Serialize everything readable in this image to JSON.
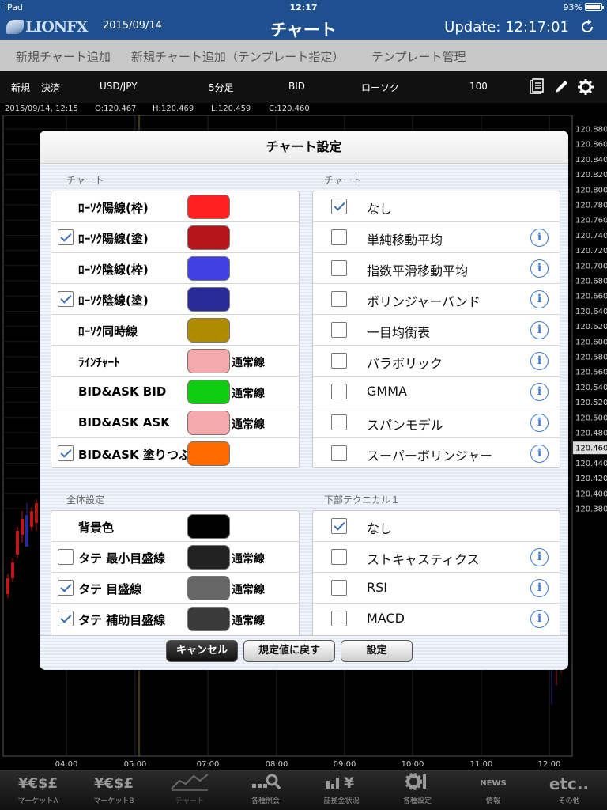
{
  "status_bar": {
    "device": "iPad",
    "time": "12:17",
    "battery": "93%"
  },
  "header": {
    "logo": "LIONFX",
    "date": "2015/09/14",
    "title": "チャート",
    "update": "Update: 12:17:01"
  },
  "sub_menu": [
    "新規チャート追加",
    "新規チャート追加（テンプレート指定）",
    "テンプレート管理"
  ],
  "toolbar": {
    "new": "新規",
    "settle": "決済",
    "pair": "USD/JPY",
    "interval": "5分足",
    "bid": "BID",
    "type": "ローソク",
    "count": "100"
  },
  "ohlc": {
    "time": "2015/09/14, 12:15",
    "o": "O:120.467",
    "h": "H:120.469",
    "l": "L:120.459",
    "c": "C:120.460"
  },
  "chart_data": {
    "type": "candlestick",
    "price_ticks": [
      "120.880",
      "120.860",
      "120.840",
      "120.820",
      "120.800",
      "120.780",
      "120.760",
      "120.740",
      "120.720",
      "120.700",
      "120.680",
      "120.660",
      "120.640",
      "120.620",
      "120.600",
      "120.580",
      "120.560",
      "120.540",
      "120.520",
      "120.500",
      "120.480",
      "120.460",
      "120.440",
      "120.420",
      "120.400",
      "120.380"
    ],
    "time_ticks": [
      "04:00",
      "05:00",
      "07:00",
      "08:00",
      "09:00",
      "10:00",
      "11:00",
      "12:00"
    ],
    "current_price": "120.460",
    "ylim": [
      120.37,
      120.89
    ]
  },
  "tabs": [
    {
      "icon": "¥€$£",
      "label": "マーケットA"
    },
    {
      "icon": "¥€$£",
      "label": "マーケットB"
    },
    {
      "icon": "",
      "label": "チャート"
    },
    {
      "icon": "",
      "label": "各種照会"
    },
    {
      "icon": "",
      "label": "証拠金状況"
    },
    {
      "icon": "",
      "label": "各種設定"
    },
    {
      "icon": "NEWS",
      "label": "情報"
    },
    {
      "icon": "etc..",
      "label": "その他"
    }
  ],
  "dialog": {
    "title": "チャート設定",
    "left_section_1": "チャート",
    "right_section_1": "チャート",
    "left_section_2": "全体設定",
    "right_section_2": "下部テクニカル１",
    "left_rows_1": [
      {
        "label": "ﾛｰｿｸ陽線(枠)",
        "checkbox": false,
        "checked": false,
        "color": "#ff2020",
        "note": ""
      },
      {
        "label": "ﾛｰｿｸ陽線(塗)",
        "checkbox": true,
        "checked": true,
        "color": "#b4141a",
        "note": ""
      },
      {
        "label": "ﾛｰｿｸ陰線(枠)",
        "checkbox": false,
        "checked": false,
        "color": "#4040e4",
        "note": ""
      },
      {
        "label": "ﾛｰｿｸ陰線(塗)",
        "checkbox": true,
        "checked": true,
        "color": "#2a2a9a",
        "note": ""
      },
      {
        "label": "ﾛｰｿｸ同時線",
        "checkbox": false,
        "checked": false,
        "color": "#b08a00",
        "note": ""
      },
      {
        "label": "ﾗｲﾝﾁｬｰﾄ",
        "checkbox": false,
        "checked": false,
        "color": "#f4aaaa",
        "note": "通常線"
      },
      {
        "label": "BID&ASK BID",
        "checkbox": false,
        "checked": false,
        "color": "#10cc10",
        "note": "通常線"
      },
      {
        "label": "BID&ASK ASK",
        "checkbox": false,
        "checked": false,
        "color": "#f4aaaa",
        "note": "通常線"
      },
      {
        "label": "BID&ASK 塗りつぶし",
        "checkbox": true,
        "checked": true,
        "color": "#ff6a00",
        "note": ""
      }
    ],
    "right_rows_1": [
      {
        "label": "なし",
        "checked": true,
        "info": false
      },
      {
        "label": "単純移動平均",
        "checked": false,
        "info": true
      },
      {
        "label": "指数平滑移動平均",
        "checked": false,
        "info": true
      },
      {
        "label": "ボリンジャーバンド",
        "checked": false,
        "info": true
      },
      {
        "label": "一目均衡表",
        "checked": false,
        "info": true
      },
      {
        "label": "パラボリック",
        "checked": false,
        "info": true
      },
      {
        "label": "GMMA",
        "checked": false,
        "info": true
      },
      {
        "label": "スパンモデル",
        "checked": false,
        "info": true
      },
      {
        "label": "スーパーボリンジャー",
        "checked": false,
        "info": true
      }
    ],
    "left_rows_2": [
      {
        "label": "背景色",
        "checkbox": false,
        "checked": false,
        "color": "#000000",
        "note": ""
      },
      {
        "label": "タテ 最小目盛線",
        "checkbox": true,
        "checked": false,
        "color": "#222222",
        "note": "通常線"
      },
      {
        "label": "タテ 目盛線",
        "checkbox": true,
        "checked": true,
        "color": "#666666",
        "note": "通常線"
      },
      {
        "label": "タテ 補助目盛線",
        "checkbox": true,
        "checked": true,
        "color": "#3a3a3a",
        "note": "通常線"
      }
    ],
    "right_rows_2": [
      {
        "label": "なし",
        "checked": true,
        "info": false
      },
      {
        "label": "ストキャスティクス",
        "checked": false,
        "info": true
      },
      {
        "label": "RSI",
        "checked": false,
        "info": true
      },
      {
        "label": "MACD",
        "checked": false,
        "info": true
      }
    ],
    "buttons": {
      "cancel": "キャンセル",
      "reset": "規定値に戻す",
      "ok": "設定"
    }
  }
}
